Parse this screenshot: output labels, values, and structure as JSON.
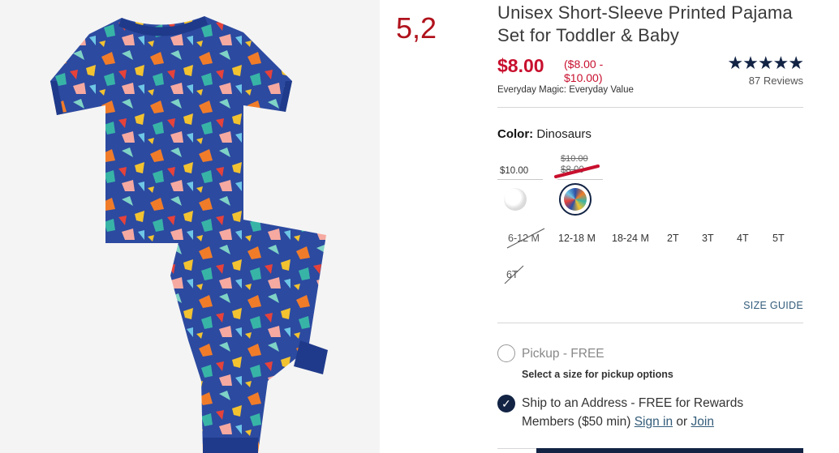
{
  "annotation": "5,2",
  "product": {
    "title": "Unisex Short-Sleeve Printed Pajama Set for Toddler & Baby",
    "price": "$8.00",
    "range_line1": "($8.00 -",
    "range_line2": "$10.00)",
    "tagline": "Everyday Magic: Everyday Value",
    "stars": "★★★★★",
    "reviews": "87 Reviews"
  },
  "color": {
    "label": "Color:",
    "value": "Dinosaurs",
    "swatches": [
      {
        "price": "$10.00"
      },
      {
        "old_price": "$10.00",
        "new_price": "$8.00"
      }
    ]
  },
  "sizes": [
    {
      "label": "6-12 M",
      "available": false
    },
    {
      "label": "12-18 M",
      "available": true
    },
    {
      "label": "18-24 M",
      "available": true
    },
    {
      "label": "2T",
      "available": true
    },
    {
      "label": "3T",
      "available": true
    },
    {
      "label": "4T",
      "available": true
    },
    {
      "label": "5T",
      "available": true
    },
    {
      "label": "6T",
      "available": false
    }
  ],
  "size_guide": "SIZE GUIDE",
  "fulfillment": {
    "pickup_label": "Pickup - FREE",
    "pickup_note": "Select a size for pickup options",
    "ship_line1": "Ship to an Address - FREE for Rewards",
    "ship_line2_prefix": "Members ($50 min)",
    "sign_in": "Sign in",
    "or": "or",
    "join": "Join"
  },
  "colors": {
    "price_red": "#c8102e",
    "navy": "#122344",
    "annotation_red": "#b0121c"
  }
}
